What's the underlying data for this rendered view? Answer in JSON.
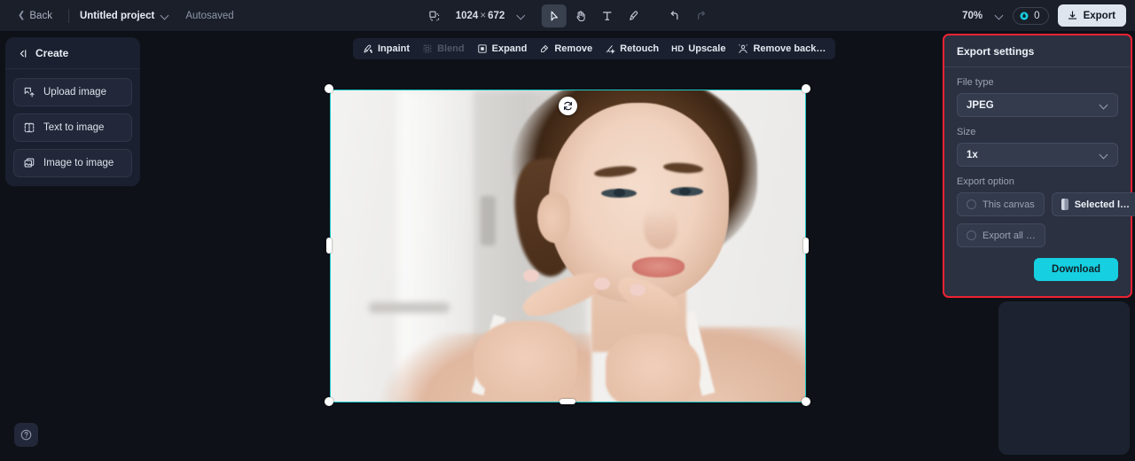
{
  "topbar": {
    "back_label": "Back",
    "project_name": "Untitled project",
    "autosaved_label": "Autosaved",
    "canvas_width": "1024",
    "canvas_multiply": "×",
    "canvas_height": "672",
    "tools": [
      {
        "name": "frame-icon",
        "label": "Frame"
      },
      {
        "name": "select-icon",
        "label": "Select"
      },
      {
        "name": "hand-icon",
        "label": "Hand"
      },
      {
        "name": "text-icon",
        "label": "Text"
      },
      {
        "name": "brush-icon",
        "label": "Brush"
      },
      {
        "name": "undo-icon",
        "label": "Undo"
      },
      {
        "name": "redo-icon",
        "label": "Redo"
      }
    ],
    "zoom_level": "70%",
    "credits_count": "0",
    "export_label": "Export"
  },
  "create_panel": {
    "title": "Create",
    "collapse_icon": "collapse-left-icon",
    "items": [
      {
        "label": "Upload image",
        "icon": "upload-image-icon"
      },
      {
        "label": "Text to image",
        "icon": "text-to-image-icon"
      },
      {
        "label": "Image to image",
        "icon": "image-to-image-icon"
      }
    ]
  },
  "edit_toolbar": {
    "items": [
      {
        "label": "Inpaint",
        "icon": "inpaint-icon",
        "disabled": false
      },
      {
        "label": "Blend",
        "icon": "blend-icon",
        "disabled": true
      },
      {
        "label": "Expand",
        "icon": "expand-icon",
        "disabled": false
      },
      {
        "label": "Remove",
        "icon": "remove-icon",
        "disabled": false
      },
      {
        "label": "Retouch",
        "icon": "retouch-icon",
        "disabled": false
      },
      {
        "label": "HD Upscale",
        "icon": "hd-badge-icon",
        "disabled": false
      },
      {
        "label": "Remove back…",
        "icon": "remove-background-icon",
        "disabled": false
      }
    ]
  },
  "canvas": {
    "rotate_icon": "rotate-icon",
    "selection_color": "#1ec8c8",
    "image_alt": "Portrait of a young woman touching her cheek in a bright bathroom"
  },
  "export_settings": {
    "title": "Export settings",
    "highlight_color": "#ee2233",
    "file_type_label": "File type",
    "file_type_value": "JPEG",
    "size_label": "Size",
    "size_value": "1x",
    "export_option_label": "Export option",
    "options": [
      {
        "label": "This canvas",
        "selected": false
      },
      {
        "label": "Selected l…",
        "selected": true
      },
      {
        "label": "Export all …",
        "selected": false
      }
    ],
    "download_label": "Download",
    "download_color": "#16cfe0"
  },
  "help": {
    "icon": "help-circle-icon",
    "label": "Help"
  }
}
